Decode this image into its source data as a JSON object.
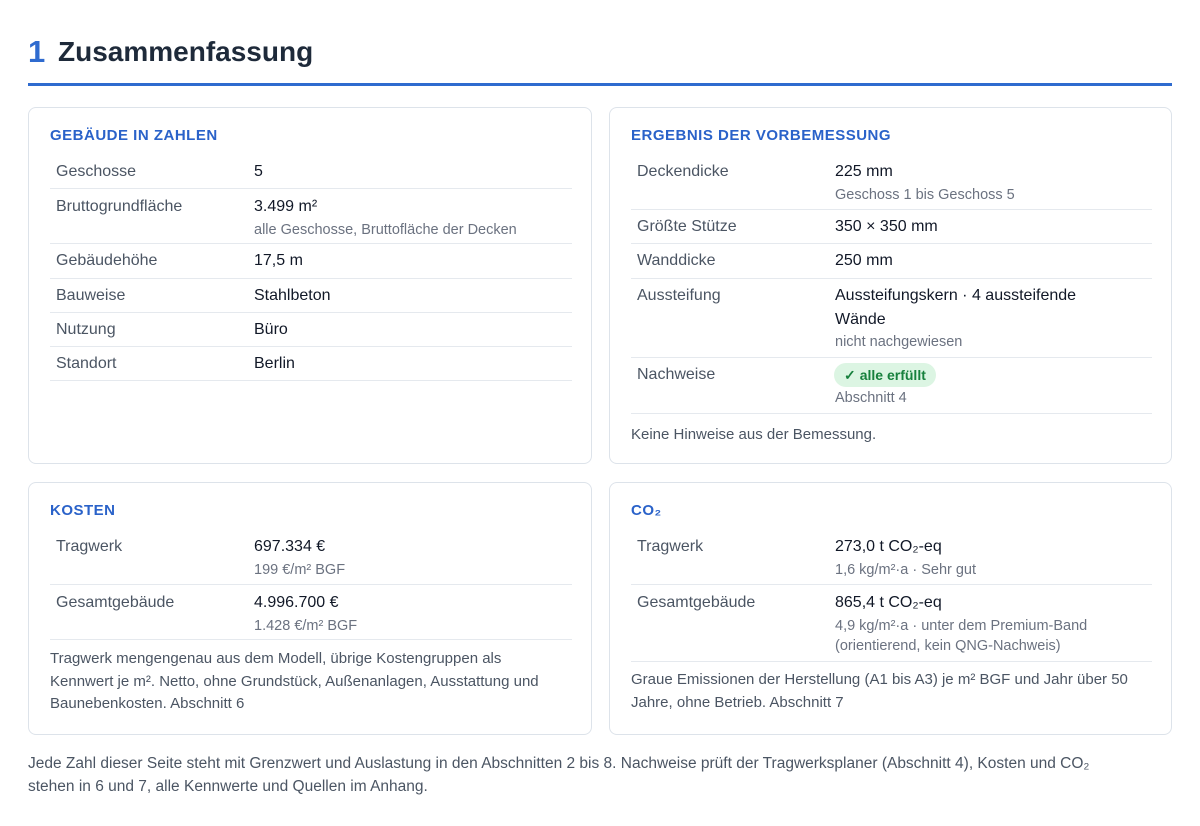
{
  "section": {
    "number": "1",
    "title": "Zusammenfassung"
  },
  "building": {
    "title": "GEBÄUDE IN ZAHLEN",
    "rows": [
      {
        "label": "Geschosse",
        "value": "5"
      },
      {
        "label": "Bruttogrundfläche",
        "value": "3.499 m²",
        "sub": "alle Geschosse, Bruttofläche der Decken"
      },
      {
        "label": "Gebäudehöhe",
        "value": "17,5 m"
      },
      {
        "label": "Bauweise",
        "value": "Stahlbeton"
      },
      {
        "label": "Nutzung",
        "value": "Büro"
      },
      {
        "label": "Standort",
        "value": "Berlin"
      }
    ]
  },
  "design": {
    "title": "ERGEBNIS DER VORBEMESSUNG",
    "rows": [
      {
        "label": "Deckendicke",
        "value": "225 mm",
        "sub": "Geschoss 1 bis Geschoss 5"
      },
      {
        "label": "Größte Stütze",
        "value": "350 × 350 mm"
      },
      {
        "label": "Wanddicke",
        "value": "250 mm"
      },
      {
        "label": "Aussteifung",
        "value_line1": "Aussteifungskern · 4 aussteifende",
        "value_line2": "Wände",
        "sub": "nicht nachgewiesen"
      },
      {
        "label": "Nachweise",
        "badge": "alle erfüllt",
        "badge_icon": "✓",
        "sub": "Abschnitt 4"
      }
    ],
    "note": "Keine Hinweise aus der Bemessung."
  },
  "costs": {
    "title": "KOSTEN",
    "rows": [
      {
        "label": "Tragwerk",
        "value": "697.334 €",
        "sub": "199 €/m² BGF"
      },
      {
        "label": "Gesamtgebäude",
        "value": "4.996.700 €",
        "sub": "1.428 €/m² BGF"
      }
    ],
    "note_line1": "Tragwerk mengengenau aus dem Modell, übrige Kostengruppen als",
    "note_line2": "Kennwert je m². Netto, ohne Grundstück, Außenanlagen, Ausstattung und",
    "note_line3": "Baunebenkosten. Abschnitt 6"
  },
  "co2": {
    "title": "CO₂",
    "rows": [
      {
        "label": "Tragwerk",
        "value": "273,0 t CO₂-eq",
        "sub": "1,6 kg/m²·a · Sehr gut"
      },
      {
        "label": "Gesamtgebäude",
        "value": "865,4 t CO₂-eq",
        "sub_line1": "4,9 kg/m²·a · unter dem Premium-Band",
        "sub_line2": "(orientierend, kein QNG-Nachweis)"
      }
    ],
    "note_line1": "Graue Emissionen der Herstellung (A1 bis A3) je m² BGF und Jahr über 50",
    "note_line2": "Jahre, ohne Betrieb. Abschnitt 7"
  },
  "footer": {
    "line1": "Jede Zahl dieser Seite steht mit Grenzwert und Auslastung in den Abschnitten 2 bis 8. Nachweise prüft der Tragwerksplaner (Abschnitt 4), Kosten und CO₂",
    "line2": "stehen in 6 und 7, alle Kennwerte und Quellen im Anhang."
  },
  "colors": {
    "accent": "#2f6bcf",
    "badge_bg": "#dcf5e3",
    "badge_text": "#17803d"
  }
}
